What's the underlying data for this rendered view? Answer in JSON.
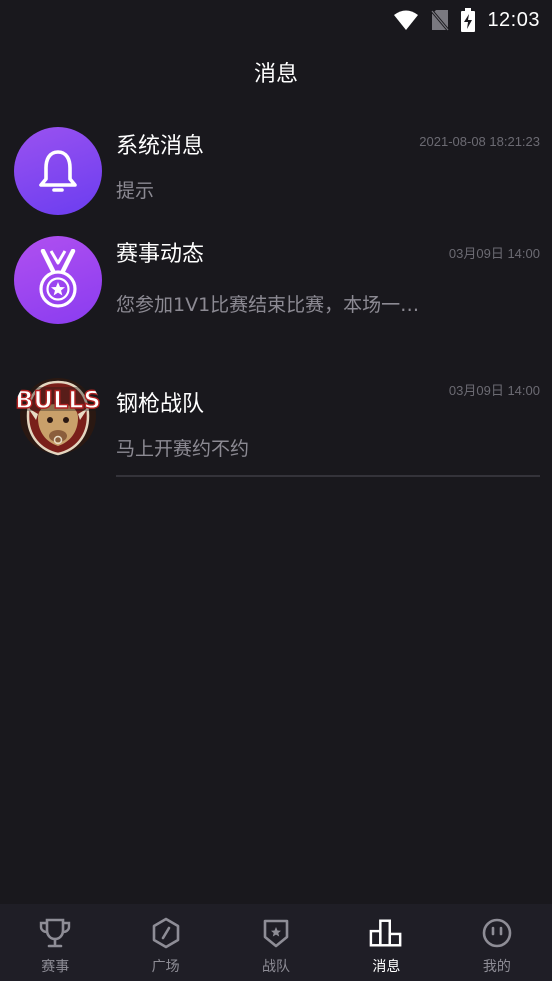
{
  "status_bar": {
    "time": "12:03"
  },
  "header": {
    "title": "消息"
  },
  "messages": [
    {
      "title": "系统消息",
      "preview": "提示",
      "time": "2021-08-08 18:21:23",
      "avatar_icon": "bell-icon"
    },
    {
      "title": "赛事动态",
      "preview": "您参加1V1比赛结束比赛，本场一…",
      "time": "03月09日 14:00",
      "avatar_icon": "medal-icon"
    },
    {
      "title": "钢枪战队",
      "preview": "马上开赛约不约",
      "time": "03月09日 14:00",
      "avatar_icon": "team-logo",
      "logo_text": "BULLS"
    }
  ],
  "nav": {
    "items": [
      {
        "label": "赛事",
        "icon": "trophy-icon"
      },
      {
        "label": "广场",
        "icon": "compass-icon"
      },
      {
        "label": "战队",
        "icon": "shield-icon"
      },
      {
        "label": "消息",
        "icon": "chart-icon",
        "active": true
      },
      {
        "label": "我的",
        "icon": "face-icon"
      }
    ]
  },
  "colors": {
    "background": "#19181d",
    "accent": "#8a3cf0",
    "nav_bg": "#1f1e26",
    "muted": "#8c8a93"
  }
}
